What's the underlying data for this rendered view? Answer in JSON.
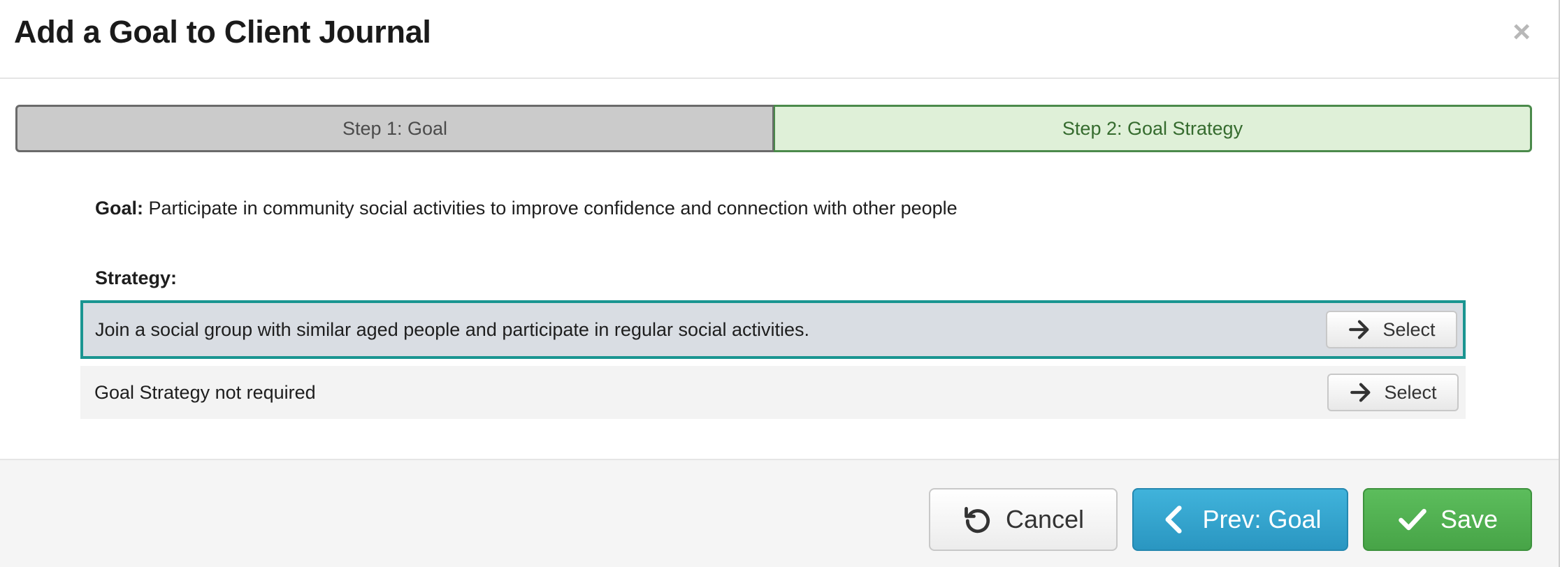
{
  "dialog": {
    "title": "Add a Goal to Client Journal",
    "close_glyph": "×"
  },
  "steps": [
    {
      "label": "Step 1: Goal",
      "active": false
    },
    {
      "label": "Step 2: Goal Strategy",
      "active": true
    }
  ],
  "goal": {
    "label": "Goal:",
    "text": "Participate in community social activities to improve confidence and connection with other people"
  },
  "strategy": {
    "label": "Strategy:",
    "options": [
      {
        "text": "Join a social group with similar aged people and participate in regular social activities.",
        "button_label": "Select",
        "icon": "arrow-right-icon",
        "highlighted": true
      },
      {
        "text": "Goal Strategy not required",
        "button_label": "Select",
        "icon": "arrow-right-icon",
        "highlighted": false
      }
    ]
  },
  "footer": {
    "cancel_label": "Cancel",
    "cancel_icon": "undo-icon",
    "prev_label": "Prev: Goal",
    "prev_icon": "chevron-left-icon",
    "save_label": "Save",
    "save_icon": "checkmark-icon"
  },
  "colors": {
    "step_active_bg": "#dff0d8",
    "step_active_text": "#356b2e",
    "step_inactive_bg": "#cbcbcb",
    "highlight_border": "#1a9591",
    "prev_button": "#2a96c1",
    "save_button": "#47a447"
  }
}
